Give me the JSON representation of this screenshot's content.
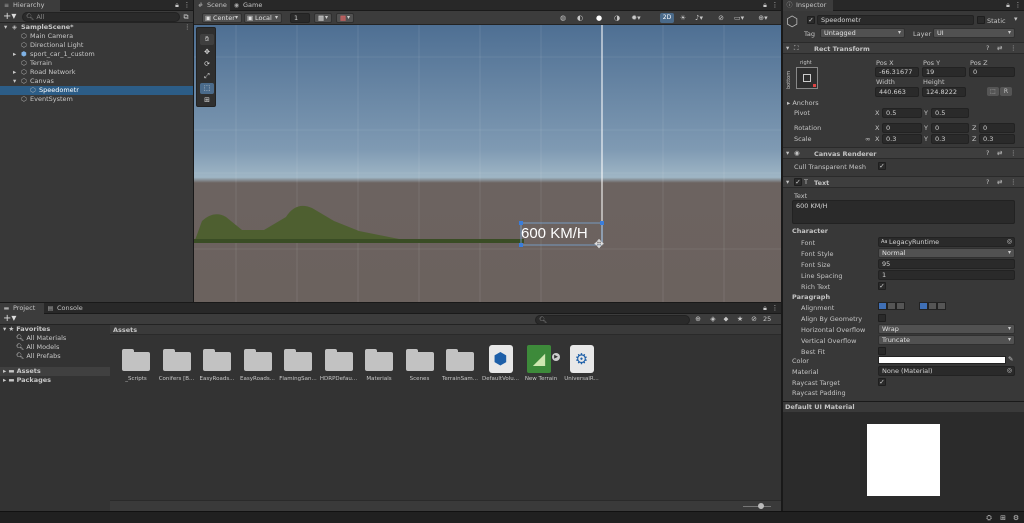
{
  "hierarchy": {
    "tab_label": "Hierarchy",
    "search_placeholder": "All",
    "items": [
      {
        "label": "SampleScene*",
        "indent": 0,
        "arrow": "▾",
        "icon": "unity-scene-icon",
        "bold": true
      },
      {
        "label": "Main Camera",
        "indent": 1,
        "arrow": "",
        "icon": "gameobject-cube-icon"
      },
      {
        "label": "Directional Light",
        "indent": 1,
        "arrow": "",
        "icon": "gameobject-cube-icon"
      },
      {
        "label": "sport_car_1_custom",
        "indent": 1,
        "arrow": "▸",
        "icon": "prefab-cube-icon"
      },
      {
        "label": "Terrain",
        "indent": 1,
        "arrow": "",
        "icon": "gameobject-cube-icon"
      },
      {
        "label": "Road Network",
        "indent": 1,
        "arrow": "▸",
        "icon": "gameobject-cube-icon"
      },
      {
        "label": "Canvas",
        "indent": 1,
        "arrow": "▾",
        "icon": "gameobject-cube-icon"
      },
      {
        "label": "Speedometr",
        "indent": 2,
        "arrow": "",
        "icon": "gameobject-cube-icon",
        "selected": true
      },
      {
        "label": "EventSystem",
        "indent": 1,
        "arrow": "",
        "icon": "gameobject-cube-icon"
      }
    ]
  },
  "scene": {
    "tabs": [
      {
        "label": "Scene",
        "icon": "scene-hash-icon"
      },
      {
        "label": "Game",
        "icon": "gamepad-icon"
      }
    ],
    "toolbar": {
      "pivot": "Center",
      "space": "Local",
      "grid_value": "1",
      "mode_2d": "2D"
    },
    "overlay_text": "600 KM/H"
  },
  "project": {
    "tabs": [
      {
        "label": "Project",
        "icon": "folder-icon"
      },
      {
        "label": "Console",
        "icon": "console-icon"
      }
    ],
    "favorites_label": "Favorites",
    "favorites": [
      "All Materials",
      "All Models",
      "All Prefabs"
    ],
    "assets_label": "Assets",
    "packages_label": "Packages",
    "breadcrumb": "Assets",
    "hidden_count": "25",
    "assets": [
      {
        "label": "_Scripts",
        "type": "folder"
      },
      {
        "label": "Conifers [B...",
        "type": "folder"
      },
      {
        "label": "EasyRoads...",
        "type": "folder"
      },
      {
        "label": "EasyRoads...",
        "type": "folder"
      },
      {
        "label": "FlamingSan...",
        "type": "folder"
      },
      {
        "label": "HDRPDefau...",
        "type": "folder"
      },
      {
        "label": "Materials",
        "type": "folder"
      },
      {
        "label": "Scenes",
        "type": "folder"
      },
      {
        "label": "TerrainSam...",
        "type": "folder"
      },
      {
        "label": "DefaultVolu...",
        "type": "volume-profile"
      },
      {
        "label": "New Terrain",
        "type": "terrain-data"
      },
      {
        "label": "UniversalR...",
        "type": "render-pipeline"
      }
    ]
  },
  "inspector": {
    "tab_label": "Inspector",
    "object_name": "Speedometr",
    "static_label": "Static",
    "tag_label": "Tag",
    "tag_value": "Untagged",
    "layer_label": "Layer",
    "layer_value": "UI",
    "rect_transform": {
      "title": "Rect Transform",
      "anchor_h": "right",
      "anchor_v": "bottom",
      "pos_x_label": "Pos X",
      "pos_y_label": "Pos Y",
      "pos_z_label": "Pos Z",
      "pos_x": "-66.31677",
      "pos_y": "19",
      "pos_z": "0",
      "width_label": "Width",
      "height_label": "Height",
      "width": "440.663",
      "height": "124.8222",
      "anchors_label": "Anchors",
      "pivot_label": "Pivot",
      "pivot_x": "0.5",
      "pivot_y": "0.5",
      "rotation_label": "Rotation",
      "rot_x": "0",
      "rot_y": "0",
      "rot_z": "0",
      "scale_label": "Scale",
      "scale_x": "0.3",
      "scale_y": "0.3",
      "scale_z": "0.3",
      "x": "X",
      "y": "Y",
      "z": "Z"
    },
    "canvas_renderer": {
      "title": "Canvas Renderer",
      "cull_label": "Cull Transparent Mesh"
    },
    "text": {
      "title": "Text",
      "text_label": "Text",
      "text_value": "600 KM/H",
      "character_label": "Character",
      "font_label": "Font",
      "font_value": "LegacyRuntime",
      "font_style_label": "Font Style",
      "font_style_value": "Normal",
      "font_size_label": "Font Size",
      "font_size_value": "95",
      "line_spacing_label": "Line Spacing",
      "line_spacing_value": "1",
      "rich_text_label": "Rich Text",
      "paragraph_label": "Paragraph",
      "alignment_label": "Alignment",
      "align_geometry_label": "Align By Geometry",
      "hoverflow_label": "Horizontal Overflow",
      "hoverflow_value": "Wrap",
      "voverflow_label": "Vertical Overflow",
      "voverflow_value": "Truncate",
      "best_fit_label": "Best Fit",
      "color_label": "Color",
      "material_label": "Material",
      "material_value": "None (Material)",
      "raycast_target_label": "Raycast Target",
      "raycast_padding_label": "Raycast Padding"
    },
    "preview_label": "Default UI Material"
  }
}
